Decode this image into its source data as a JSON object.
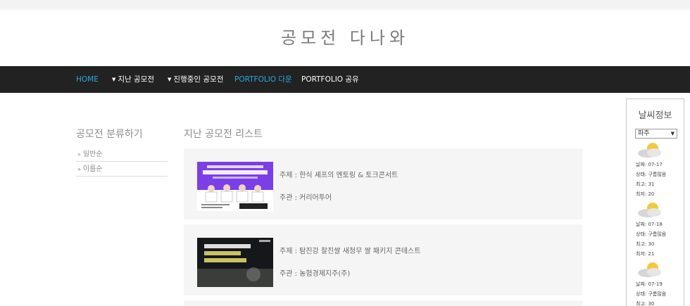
{
  "site": {
    "title": "공모전 다나와"
  },
  "nav": {
    "items": [
      {
        "label": "HOME",
        "active": true,
        "dropdown": false
      },
      {
        "label": "지난 공모전",
        "active": false,
        "dropdown": true
      },
      {
        "label": "진행중인 공모전",
        "active": false,
        "dropdown": true
      },
      {
        "label": "PORTFOLIO 다운",
        "active": true,
        "dropdown": false
      },
      {
        "label": "PORTFOLIO 공유",
        "active": false,
        "dropdown": false
      }
    ]
  },
  "sidebar": {
    "heading": "공모전 분류하기",
    "links": [
      {
        "label": "일반순"
      },
      {
        "label": "이름순"
      }
    ]
  },
  "main": {
    "heading": "지난 공모전 리스트",
    "cards": [
      {
        "topic": "주제 : 한식 셰프의 멘토링 & 토크콘서트",
        "host": "주관 : 커리어투어"
      },
      {
        "topic": "주제 : 탐진강 찰진쌀 새청무 쌀 패키지 콘테스트",
        "host": "주관 : 농협경제지주(주)"
      }
    ]
  },
  "weather": {
    "title": "날씨정보",
    "location": "파주",
    "days": [
      {
        "date": "날짜: 07-17",
        "status": "상태: 구름많음",
        "high": "최고: 31",
        "low": "최저: 20"
      },
      {
        "date": "날짜: 07-18",
        "status": "상태: 구름많음",
        "high": "최고: 30",
        "low": "최저: 21"
      },
      {
        "date": "날짜: 07-19",
        "status": "상태: 구름많음",
        "high": "최고: 30"
      }
    ]
  }
}
